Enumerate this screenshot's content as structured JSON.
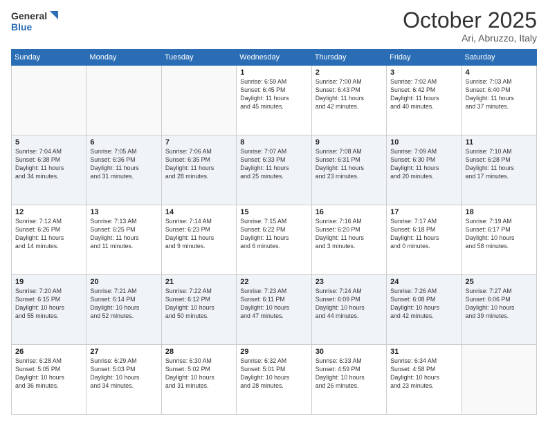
{
  "header": {
    "logo_general": "General",
    "logo_blue": "Blue",
    "month_title": "October 2025",
    "location": "Ari, Abruzzo, Italy"
  },
  "days_of_week": [
    "Sunday",
    "Monday",
    "Tuesday",
    "Wednesday",
    "Thursday",
    "Friday",
    "Saturday"
  ],
  "weeks": [
    [
      {
        "day": "",
        "info": ""
      },
      {
        "day": "",
        "info": ""
      },
      {
        "day": "",
        "info": ""
      },
      {
        "day": "1",
        "info": "Sunrise: 6:59 AM\nSunset: 6:45 PM\nDaylight: 11 hours\nand 45 minutes."
      },
      {
        "day": "2",
        "info": "Sunrise: 7:00 AM\nSunset: 6:43 PM\nDaylight: 11 hours\nand 42 minutes."
      },
      {
        "day": "3",
        "info": "Sunrise: 7:02 AM\nSunset: 6:42 PM\nDaylight: 11 hours\nand 40 minutes."
      },
      {
        "day": "4",
        "info": "Sunrise: 7:03 AM\nSunset: 6:40 PM\nDaylight: 11 hours\nand 37 minutes."
      }
    ],
    [
      {
        "day": "5",
        "info": "Sunrise: 7:04 AM\nSunset: 6:38 PM\nDaylight: 11 hours\nand 34 minutes."
      },
      {
        "day": "6",
        "info": "Sunrise: 7:05 AM\nSunset: 6:36 PM\nDaylight: 11 hours\nand 31 minutes."
      },
      {
        "day": "7",
        "info": "Sunrise: 7:06 AM\nSunset: 6:35 PM\nDaylight: 11 hours\nand 28 minutes."
      },
      {
        "day": "8",
        "info": "Sunrise: 7:07 AM\nSunset: 6:33 PM\nDaylight: 11 hours\nand 25 minutes."
      },
      {
        "day": "9",
        "info": "Sunrise: 7:08 AM\nSunset: 6:31 PM\nDaylight: 11 hours\nand 23 minutes."
      },
      {
        "day": "10",
        "info": "Sunrise: 7:09 AM\nSunset: 6:30 PM\nDaylight: 11 hours\nand 20 minutes."
      },
      {
        "day": "11",
        "info": "Sunrise: 7:10 AM\nSunset: 6:28 PM\nDaylight: 11 hours\nand 17 minutes."
      }
    ],
    [
      {
        "day": "12",
        "info": "Sunrise: 7:12 AM\nSunset: 6:26 PM\nDaylight: 11 hours\nand 14 minutes."
      },
      {
        "day": "13",
        "info": "Sunrise: 7:13 AM\nSunset: 6:25 PM\nDaylight: 11 hours\nand 11 minutes."
      },
      {
        "day": "14",
        "info": "Sunrise: 7:14 AM\nSunset: 6:23 PM\nDaylight: 11 hours\nand 9 minutes."
      },
      {
        "day": "15",
        "info": "Sunrise: 7:15 AM\nSunset: 6:22 PM\nDaylight: 11 hours\nand 6 minutes."
      },
      {
        "day": "16",
        "info": "Sunrise: 7:16 AM\nSunset: 6:20 PM\nDaylight: 11 hours\nand 3 minutes."
      },
      {
        "day": "17",
        "info": "Sunrise: 7:17 AM\nSunset: 6:18 PM\nDaylight: 11 hours\nand 0 minutes."
      },
      {
        "day": "18",
        "info": "Sunrise: 7:19 AM\nSunset: 6:17 PM\nDaylight: 10 hours\nand 58 minutes."
      }
    ],
    [
      {
        "day": "19",
        "info": "Sunrise: 7:20 AM\nSunset: 6:15 PM\nDaylight: 10 hours\nand 55 minutes."
      },
      {
        "day": "20",
        "info": "Sunrise: 7:21 AM\nSunset: 6:14 PM\nDaylight: 10 hours\nand 52 minutes."
      },
      {
        "day": "21",
        "info": "Sunrise: 7:22 AM\nSunset: 6:12 PM\nDaylight: 10 hours\nand 50 minutes."
      },
      {
        "day": "22",
        "info": "Sunrise: 7:23 AM\nSunset: 6:11 PM\nDaylight: 10 hours\nand 47 minutes."
      },
      {
        "day": "23",
        "info": "Sunrise: 7:24 AM\nSunset: 6:09 PM\nDaylight: 10 hours\nand 44 minutes."
      },
      {
        "day": "24",
        "info": "Sunrise: 7:26 AM\nSunset: 6:08 PM\nDaylight: 10 hours\nand 42 minutes."
      },
      {
        "day": "25",
        "info": "Sunrise: 7:27 AM\nSunset: 6:06 PM\nDaylight: 10 hours\nand 39 minutes."
      }
    ],
    [
      {
        "day": "26",
        "info": "Sunrise: 6:28 AM\nSunset: 5:05 PM\nDaylight: 10 hours\nand 36 minutes."
      },
      {
        "day": "27",
        "info": "Sunrise: 6:29 AM\nSunset: 5:03 PM\nDaylight: 10 hours\nand 34 minutes."
      },
      {
        "day": "28",
        "info": "Sunrise: 6:30 AM\nSunset: 5:02 PM\nDaylight: 10 hours\nand 31 minutes."
      },
      {
        "day": "29",
        "info": "Sunrise: 6:32 AM\nSunset: 5:01 PM\nDaylight: 10 hours\nand 28 minutes."
      },
      {
        "day": "30",
        "info": "Sunrise: 6:33 AM\nSunset: 4:59 PM\nDaylight: 10 hours\nand 26 minutes."
      },
      {
        "day": "31",
        "info": "Sunrise: 6:34 AM\nSunset: 4:58 PM\nDaylight: 10 hours\nand 23 minutes."
      },
      {
        "day": "",
        "info": ""
      }
    ]
  ]
}
